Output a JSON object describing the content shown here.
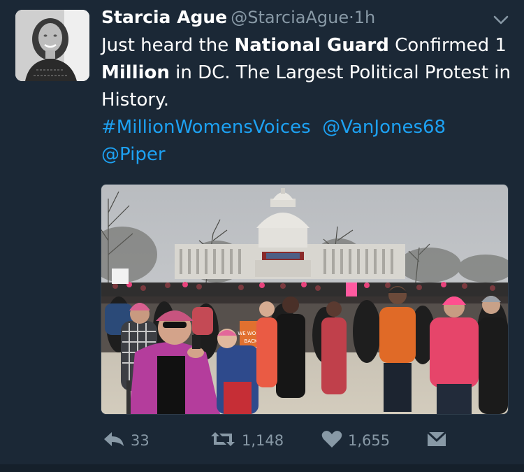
{
  "tweet": {
    "name": "Starcia Ague",
    "handle": "@StarciaAgue",
    "separator": "·",
    "time": "1h",
    "text": {
      "part1": "Just heard the ",
      "bold1": "National Guard",
      "part2": " Confirmed 1 ",
      "bold2": "Million",
      "part3": " in DC. The Largest Political Protest in History.",
      "hashtag": "#MillionWomensVoices",
      "mention1": "@VanJones68",
      "mention2": "@Piper"
    },
    "sign_text": "WE WON'T BACK DOWN"
  },
  "actions": {
    "reply_count": "33",
    "retweet_count": "1,148",
    "like_count": "1,655"
  },
  "colors": {
    "background": "#1b2836",
    "link": "#1da1f2",
    "muted": "#8899a6",
    "hat_pink": "#e8437c"
  },
  "icons": [
    "chevron-down-icon",
    "reply-icon",
    "retweet-icon",
    "heart-icon",
    "direct-message-icon"
  ]
}
